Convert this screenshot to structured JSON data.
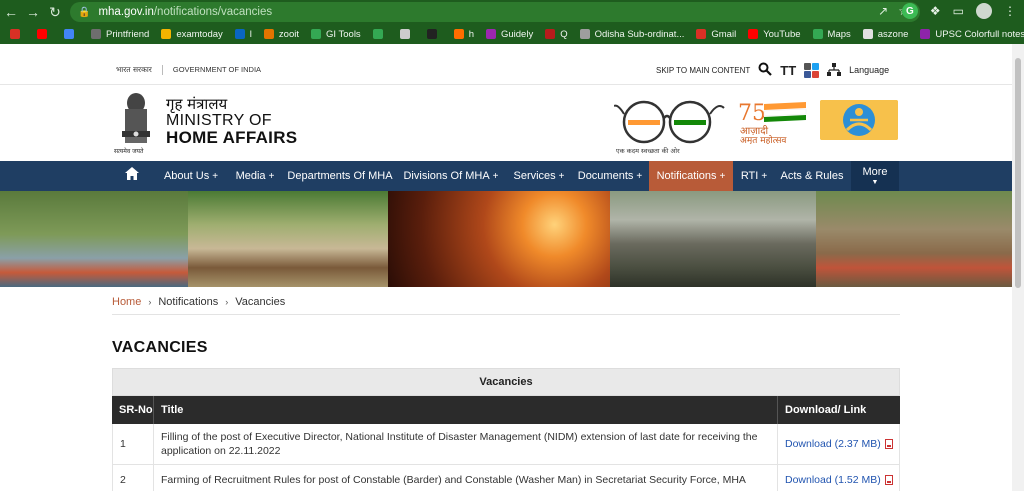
{
  "browser": {
    "url_host": "mha.gov.in",
    "url_path": "/notifications/vacancies",
    "bookmarks": [
      {
        "label": "",
        "color": "#d93025"
      },
      {
        "label": "",
        "color": "#ff0000"
      },
      {
        "label": "",
        "color": "#4285f4"
      },
      {
        "label": "Printfriend",
        "color": "#6e6e6e"
      },
      {
        "label": "examtoday",
        "color": "#f4b400"
      },
      {
        "label": "l",
        "color": "#0a66c2"
      },
      {
        "label": "zooit",
        "color": "#e37400"
      },
      {
        "label": "GI Tools",
        "color": "#34a853"
      },
      {
        "label": "",
        "color": "#34a853"
      },
      {
        "label": "",
        "color": "#cccccc"
      },
      {
        "label": "",
        "color": "#222222"
      },
      {
        "label": "h",
        "color": "#ff6d00"
      },
      {
        "label": "Guidely",
        "color": "#9c27b0"
      },
      {
        "label": "Q",
        "color": "#b71c1c"
      },
      {
        "label": "Odisha Sub-ordinat...",
        "color": "#9e9e9e"
      },
      {
        "label": "Gmail",
        "color": "#d93025"
      },
      {
        "label": "YouTube",
        "color": "#ff0000"
      },
      {
        "label": "Maps",
        "color": "#34a853"
      },
      {
        "label": "aszone",
        "color": "#e0e0e0"
      },
      {
        "label": "UPSC Colorfull notes",
        "color": "#8e24aa"
      }
    ]
  },
  "gov_bar": {
    "hindi": "भारत सरकार",
    "english": "GOVERNMENT OF INDIA",
    "skip": "SKIP TO MAIN CONTENT",
    "text_size": "TT",
    "language": "Language"
  },
  "header": {
    "ministry_hindi": "गृह मंत्रालय",
    "ministry_of": "MINISTRY OF",
    "ministry_name": "HOME AFFAIRS",
    "emblem_caption": "सत्यमेव जयते",
    "swachh_caption": "एक कदम स्वच्छता की ओर"
  },
  "nav": {
    "items": [
      {
        "label": "About Us",
        "plus": "+"
      },
      {
        "label": "Media",
        "plus": "+"
      },
      {
        "label": "Departments Of MHA",
        "plus": ""
      },
      {
        "label": "Divisions Of MHA",
        "plus": "+"
      },
      {
        "label": "Services",
        "plus": "+"
      },
      {
        "label": "Documents",
        "plus": "+"
      },
      {
        "label": "Notifications",
        "plus": "+"
      },
      {
        "label": "RTI",
        "plus": "+"
      },
      {
        "label": "Acts & Rules",
        "plus": ""
      },
      {
        "label": "More",
        "plus": ""
      }
    ],
    "colors": {
      "bar": "#1f3e63",
      "active": "#b85b38"
    }
  },
  "breadcrumb": {
    "home": "Home",
    "level1": "Notifications",
    "level2": "Vacancies"
  },
  "page_title": "VACANCIES",
  "table": {
    "caption": "Vacancies",
    "headers": [
      "SR-No",
      "Title",
      "Download/ Link"
    ],
    "rows": [
      {
        "sr": "1",
        "title": "Filling of the post of Executive Director, National Institute of Disaster Management (NIDM) extension of last date for receiving the application on 22.11.2022",
        "download": "Download (2.37 MB)"
      },
      {
        "sr": "2",
        "title": "Farming of Recruitment Rules for post of Constable (Barder) and Constable (Washer Man) in Secretariat Security Force, MHA",
        "download": "Download (1.52 MB)"
      }
    ]
  }
}
